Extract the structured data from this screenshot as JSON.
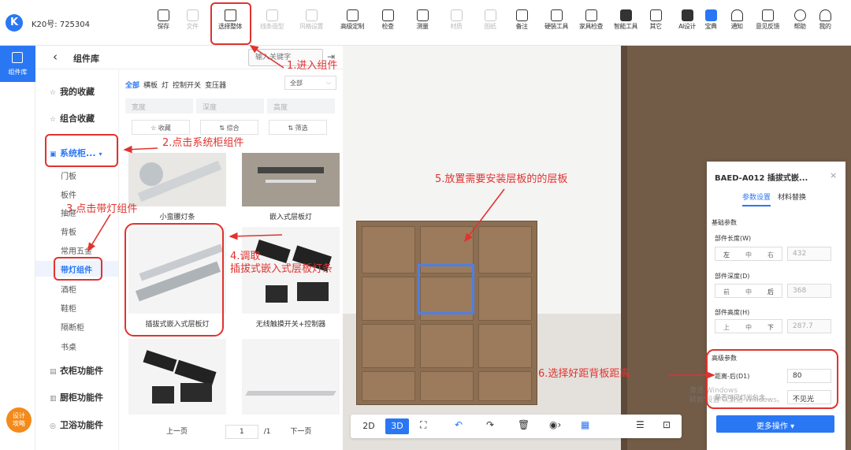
{
  "header": {
    "logo": "K",
    "account": "K20号: 725304",
    "tools": [
      {
        "label": "保存",
        "icon": "save-icon",
        "dim": false
      },
      {
        "label": "文件",
        "icon": "file-icon",
        "dim": true
      },
      {
        "label": "选择整体",
        "icon": "cube-icon",
        "dim": false
      },
      {
        "label": "线条造型",
        "icon": "line-shape-icon",
        "dim": true
      },
      {
        "label": "风格设置",
        "icon": "style-icon",
        "dim": true
      },
      {
        "label": "高级定制",
        "icon": "custom-icon",
        "dim": false
      },
      {
        "label": "检查",
        "icon": "check-icon",
        "dim": false
      },
      {
        "label": "测量",
        "icon": "measure-icon",
        "dim": false
      },
      {
        "label": "材质",
        "icon": "material-icon",
        "dim": true
      },
      {
        "label": "图纸",
        "icon": "drawing-icon",
        "dim": true
      },
      {
        "label": "备注",
        "icon": "note-icon",
        "dim": false
      },
      {
        "label": "硬装工具",
        "icon": "hardware-icon",
        "dim": false
      },
      {
        "label": "家具检查",
        "icon": "furniture-check-icon",
        "dim": false
      },
      {
        "label": "智能工具",
        "icon": "smart-tool-icon",
        "dim": false
      },
      {
        "label": "其它",
        "icon": "other-icon",
        "dim": false
      },
      {
        "label": "AI设计",
        "icon": "ai-design-icon",
        "dim": false
      },
      {
        "label": "宝典",
        "icon": "guide-icon",
        "dim": false
      },
      {
        "label": "通知",
        "icon": "bell-icon",
        "dim": false
      },
      {
        "label": "意见反馈",
        "icon": "feedback-icon",
        "dim": false
      },
      {
        "label": "帮助",
        "icon": "help-icon",
        "dim": false
      },
      {
        "label": "我的",
        "icon": "user-icon",
        "dim": false
      }
    ]
  },
  "rail": {
    "active_label": "组件库",
    "bottom_label_1": "设计",
    "bottom_label_2": "攻略"
  },
  "panel": {
    "back_glyph": "‹",
    "title": "组件库",
    "search_placeholder": "输入关键字",
    "categories": [
      {
        "label": "我的收藏",
        "icon": "☆"
      },
      {
        "label": "组合收藏",
        "icon": "☆"
      },
      {
        "label": "系统柜...",
        "icon": "▣"
      },
      {
        "label": "衣柜功能件",
        "icon": "▤"
      },
      {
        "label": "厨柜功能件",
        "icon": "▥"
      },
      {
        "label": "卫浴功能件",
        "icon": "◎"
      }
    ],
    "subcategories": [
      "门板",
      "板件",
      "抽屉",
      "背板",
      "常用五金",
      "带灯组件",
      "酒柜",
      "鞋柜",
      "隔断柜",
      "书桌"
    ],
    "filter_tabs": [
      "全部",
      "横板",
      "灯",
      "控制开关",
      "变压器"
    ],
    "filter_select": "全部",
    "filter_fields": [
      "宽度",
      "深度",
      "高度"
    ],
    "sort_buttons": [
      "☆ 收藏",
      "⇅ 综合",
      "⇅ 筛选"
    ],
    "cards": [
      {
        "caption": "小蛮腰灯条"
      },
      {
        "caption": "嵌入式层板灯"
      },
      {
        "caption": "插拔式嵌入式层板灯"
      },
      {
        "caption": "无线触摸开关+控制器"
      },
      {
        "caption": ""
      },
      {
        "caption": ""
      }
    ],
    "pager": {
      "prev": "上一页",
      "current": "1",
      "total": "/1",
      "next": "下一页"
    }
  },
  "viewport_controls": {
    "mode_2d": "2D",
    "mode_3d": "3D"
  },
  "properties": {
    "title": "BAED-A012 插拔式嵌...",
    "close": "×",
    "tab_params": "参数设置",
    "tab_material": "材料替换",
    "basic_section": "基础参数",
    "length_label": "部件长度(W)",
    "length_options": [
      "左",
      "中",
      "右"
    ],
    "length_value": "432",
    "depth_label": "部件深度(D)",
    "depth_options": [
      "前",
      "中",
      "后"
    ],
    "depth_value": "368",
    "height_label": "部件高度(H)",
    "height_options": [
      "上",
      "中",
      "下"
    ],
    "height_value": "287.7",
    "advanced_section": "高级参数",
    "back_distance_label": "距离-后(D1)",
    "back_distance_value": "80",
    "light_label": "是否可见灯光包含...",
    "light_value": "不见光",
    "more_button": "更多操作 ▾",
    "watermark_1": "激活 Windows",
    "watermark_2": "转到'设置'以激活 Windows。"
  },
  "annotations": {
    "step1": "1.进入组件",
    "step2": "2.点击系统柜组件",
    "step3": "3.点击带灯组件",
    "step4_line1": "4.调取",
    "step4_line2": "插拔式嵌入式层板灯条",
    "step5": "5.放置需要安装层板的的层板",
    "step6": "6.选择好距背板距离",
    "color": "#e0332f"
  }
}
